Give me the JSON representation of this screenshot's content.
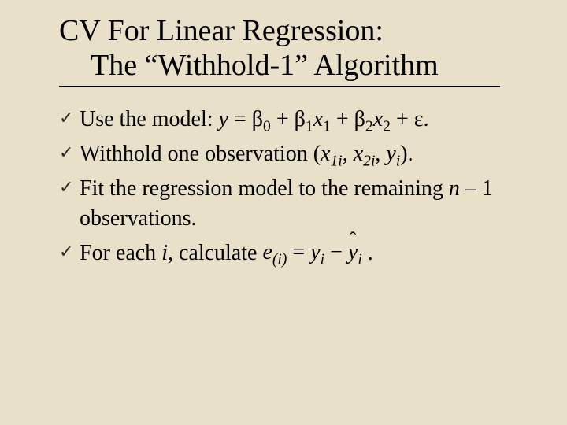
{
  "title": {
    "line1": "CV For Linear Regression:",
    "line2": "The “Withhold-1” Algorithm"
  },
  "bullet_glyph": "✓",
  "bullets": {
    "b1_lead": "Use the model: ",
    "b1_eq_y": "y",
    "b1_eq_text1": " = β",
    "b1_eq_sub0": "0",
    "b1_eq_text2": " + β",
    "b1_eq_sub1a": "1",
    "b1_eq_x1": "x",
    "b1_eq_sub1b": "1",
    "b1_eq_text3": " + β",
    "b1_eq_sub2a": "2",
    "b1_eq_x2": "x",
    "b1_eq_sub2b": "2",
    "b1_eq_text4": " + ε.",
    "b2_lead": "Withhold one observation (",
    "b2_x1": "x",
    "b2_sub1": "1i",
    "b2_mid1": ", ",
    "b2_x2": "x",
    "b2_sub2": "2i",
    "b2_mid2": ", ",
    "b2_y": "y",
    "b2_suby": "i",
    "b2_end": ").",
    "b3_lead": "Fit the regression model to the remaining ",
    "b3_n": "n",
    "b3_after_n": " – 1 observations.",
    "b4_lead": "For each ",
    "b4_i": "i,",
    "b4_after": " calculate  ",
    "b4_formula_e": "e",
    "b4_formula_sub": "(i)",
    "b4_formula_eq": " = ",
    "b4_formula_y1": "y",
    "b4_formula_sub1": "i",
    "b4_formula_minus": " − ",
    "b4_formula_y2": "y",
    "b4_formula_sub2": "i",
    "b4_period": " ."
  }
}
